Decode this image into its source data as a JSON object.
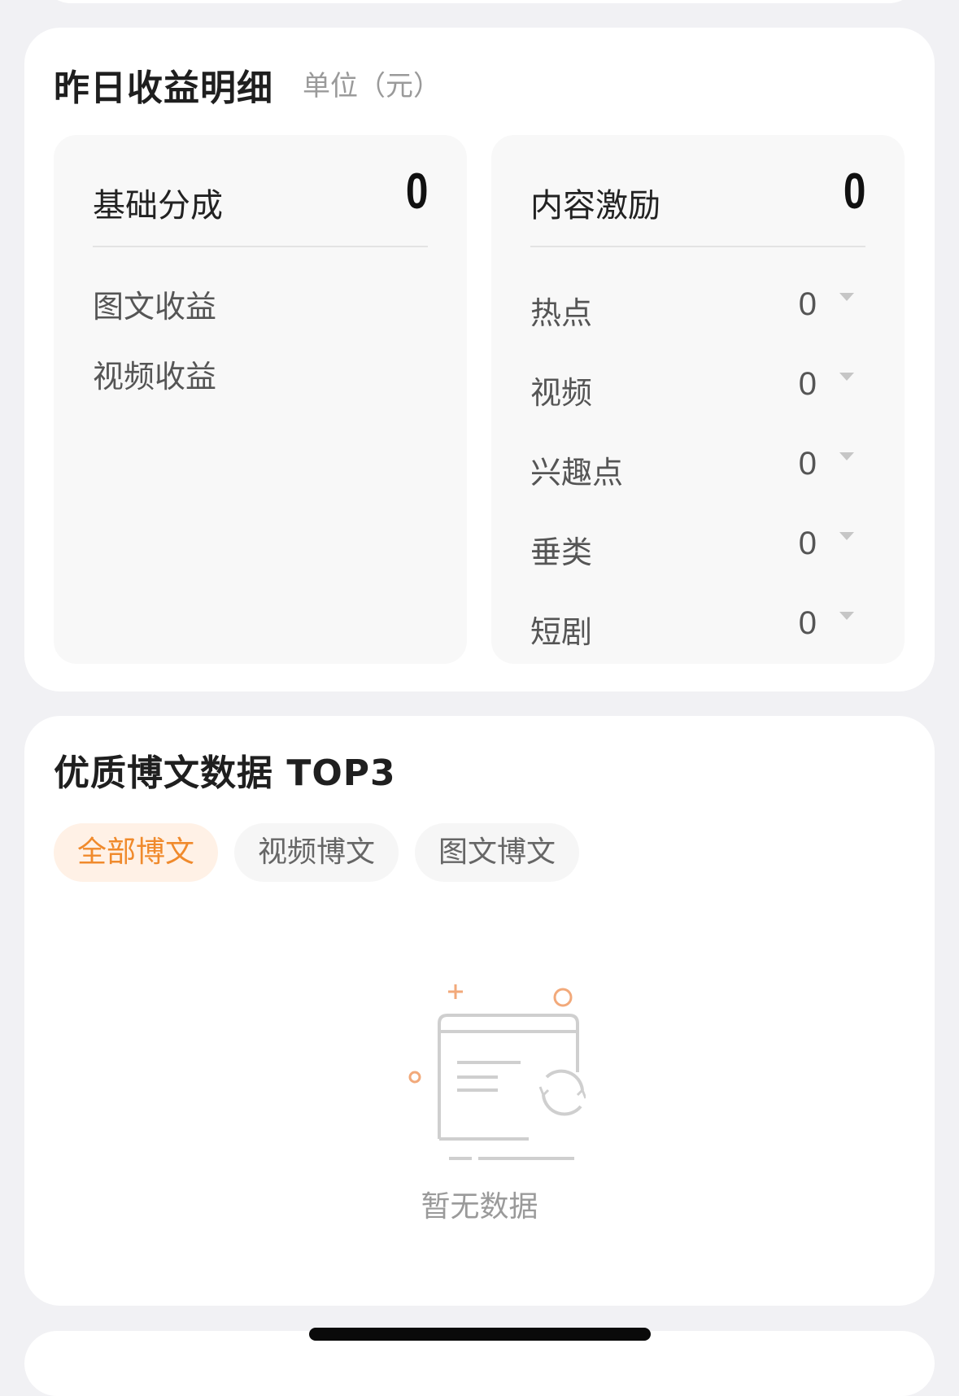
{
  "earnings": {
    "title": "昨日收益明细",
    "unit": "单位（元）",
    "base": {
      "label": "基础分成",
      "total": "0",
      "items": [
        "图文收益",
        "视频收益"
      ]
    },
    "incentive": {
      "label": "内容激励",
      "total": "0",
      "rows": [
        {
          "label": "热点",
          "value": "0"
        },
        {
          "label": "视频",
          "value": "0"
        },
        {
          "label": "兴趣点",
          "value": "0"
        },
        {
          "label": "垂类",
          "value": "0"
        },
        {
          "label": "短剧",
          "value": "0"
        }
      ]
    }
  },
  "top_posts": {
    "title": "优质博文数据 TOP3",
    "tabs": [
      {
        "label": "全部博文",
        "active": true
      },
      {
        "label": "视频博文",
        "active": false
      },
      {
        "label": "图文博文",
        "active": false
      }
    ],
    "empty_text": "暂无数据"
  },
  "colors": {
    "accent": "#f08a2c",
    "accent_bg": "#fff1e6",
    "page_bg": "#f1f1f4"
  },
  "icons": {
    "empty_state": "empty-card-refresh-icon",
    "row_caret": "caret-down-icon"
  }
}
